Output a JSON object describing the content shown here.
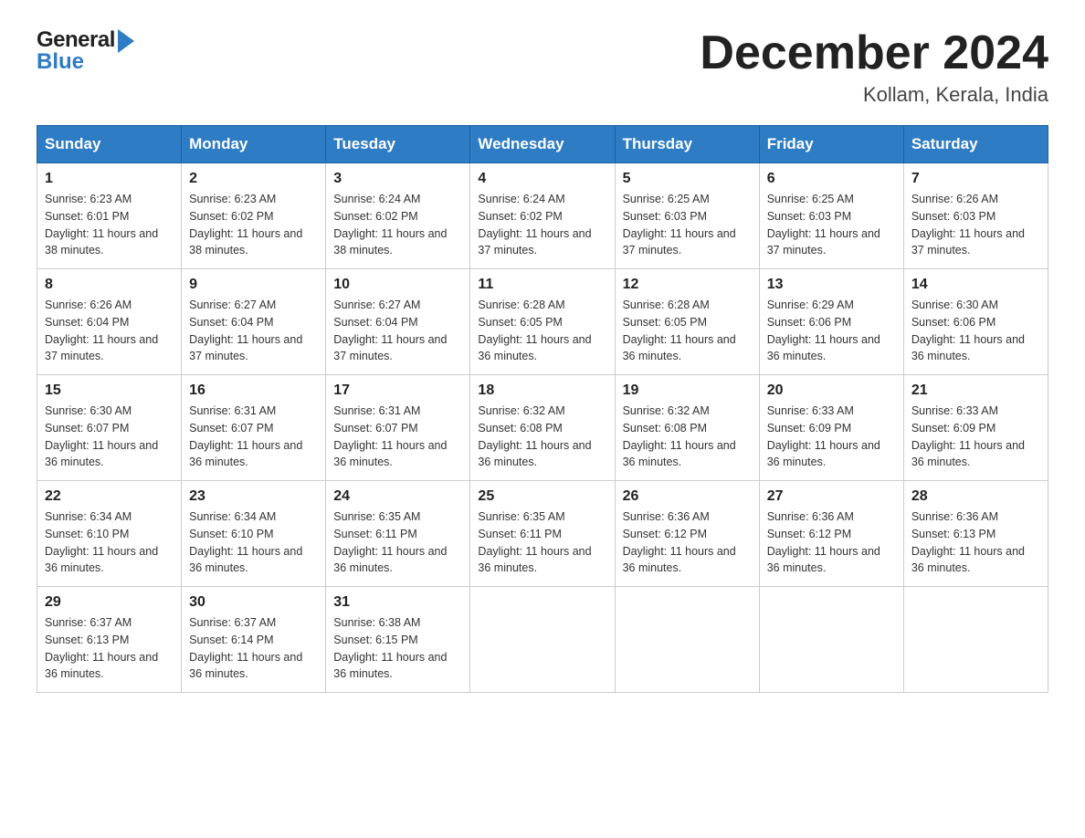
{
  "header": {
    "logo_general": "General",
    "logo_blue": "Blue",
    "main_title": "December 2024",
    "subtitle": "Kollam, Kerala, India"
  },
  "days_of_week": [
    "Sunday",
    "Monday",
    "Tuesday",
    "Wednesday",
    "Thursday",
    "Friday",
    "Saturday"
  ],
  "weeks": [
    [
      {
        "day": "1",
        "sunrise": "6:23 AM",
        "sunset": "6:01 PM",
        "daylight": "11 hours and 38 minutes."
      },
      {
        "day": "2",
        "sunrise": "6:23 AM",
        "sunset": "6:02 PM",
        "daylight": "11 hours and 38 minutes."
      },
      {
        "day": "3",
        "sunrise": "6:24 AM",
        "sunset": "6:02 PM",
        "daylight": "11 hours and 38 minutes."
      },
      {
        "day": "4",
        "sunrise": "6:24 AM",
        "sunset": "6:02 PM",
        "daylight": "11 hours and 37 minutes."
      },
      {
        "day": "5",
        "sunrise": "6:25 AM",
        "sunset": "6:03 PM",
        "daylight": "11 hours and 37 minutes."
      },
      {
        "day": "6",
        "sunrise": "6:25 AM",
        "sunset": "6:03 PM",
        "daylight": "11 hours and 37 minutes."
      },
      {
        "day": "7",
        "sunrise": "6:26 AM",
        "sunset": "6:03 PM",
        "daylight": "11 hours and 37 minutes."
      }
    ],
    [
      {
        "day": "8",
        "sunrise": "6:26 AM",
        "sunset": "6:04 PM",
        "daylight": "11 hours and 37 minutes."
      },
      {
        "day": "9",
        "sunrise": "6:27 AM",
        "sunset": "6:04 PM",
        "daylight": "11 hours and 37 minutes."
      },
      {
        "day": "10",
        "sunrise": "6:27 AM",
        "sunset": "6:04 PM",
        "daylight": "11 hours and 37 minutes."
      },
      {
        "day": "11",
        "sunrise": "6:28 AM",
        "sunset": "6:05 PM",
        "daylight": "11 hours and 36 minutes."
      },
      {
        "day": "12",
        "sunrise": "6:28 AM",
        "sunset": "6:05 PM",
        "daylight": "11 hours and 36 minutes."
      },
      {
        "day": "13",
        "sunrise": "6:29 AM",
        "sunset": "6:06 PM",
        "daylight": "11 hours and 36 minutes."
      },
      {
        "day": "14",
        "sunrise": "6:30 AM",
        "sunset": "6:06 PM",
        "daylight": "11 hours and 36 minutes."
      }
    ],
    [
      {
        "day": "15",
        "sunrise": "6:30 AM",
        "sunset": "6:07 PM",
        "daylight": "11 hours and 36 minutes."
      },
      {
        "day": "16",
        "sunrise": "6:31 AM",
        "sunset": "6:07 PM",
        "daylight": "11 hours and 36 minutes."
      },
      {
        "day": "17",
        "sunrise": "6:31 AM",
        "sunset": "6:07 PM",
        "daylight": "11 hours and 36 minutes."
      },
      {
        "day": "18",
        "sunrise": "6:32 AM",
        "sunset": "6:08 PM",
        "daylight": "11 hours and 36 minutes."
      },
      {
        "day": "19",
        "sunrise": "6:32 AM",
        "sunset": "6:08 PM",
        "daylight": "11 hours and 36 minutes."
      },
      {
        "day": "20",
        "sunrise": "6:33 AM",
        "sunset": "6:09 PM",
        "daylight": "11 hours and 36 minutes."
      },
      {
        "day": "21",
        "sunrise": "6:33 AM",
        "sunset": "6:09 PM",
        "daylight": "11 hours and 36 minutes."
      }
    ],
    [
      {
        "day": "22",
        "sunrise": "6:34 AM",
        "sunset": "6:10 PM",
        "daylight": "11 hours and 36 minutes."
      },
      {
        "day": "23",
        "sunrise": "6:34 AM",
        "sunset": "6:10 PM",
        "daylight": "11 hours and 36 minutes."
      },
      {
        "day": "24",
        "sunrise": "6:35 AM",
        "sunset": "6:11 PM",
        "daylight": "11 hours and 36 minutes."
      },
      {
        "day": "25",
        "sunrise": "6:35 AM",
        "sunset": "6:11 PM",
        "daylight": "11 hours and 36 minutes."
      },
      {
        "day": "26",
        "sunrise": "6:36 AM",
        "sunset": "6:12 PM",
        "daylight": "11 hours and 36 minutes."
      },
      {
        "day": "27",
        "sunrise": "6:36 AM",
        "sunset": "6:12 PM",
        "daylight": "11 hours and 36 minutes."
      },
      {
        "day": "28",
        "sunrise": "6:36 AM",
        "sunset": "6:13 PM",
        "daylight": "11 hours and 36 minutes."
      }
    ],
    [
      {
        "day": "29",
        "sunrise": "6:37 AM",
        "sunset": "6:13 PM",
        "daylight": "11 hours and 36 minutes."
      },
      {
        "day": "30",
        "sunrise": "6:37 AM",
        "sunset": "6:14 PM",
        "daylight": "11 hours and 36 minutes."
      },
      {
        "day": "31",
        "sunrise": "6:38 AM",
        "sunset": "6:15 PM",
        "daylight": "11 hours and 36 minutes."
      },
      null,
      null,
      null,
      null
    ]
  ]
}
